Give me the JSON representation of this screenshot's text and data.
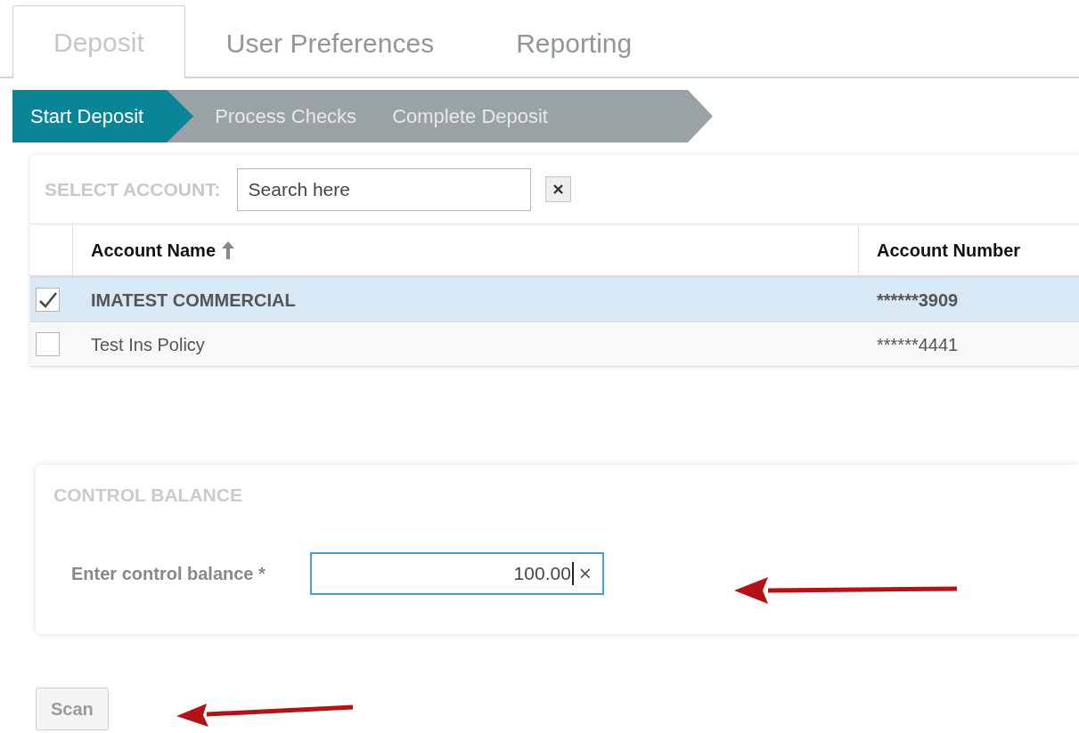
{
  "tabs": [
    {
      "label": "Deposit",
      "selected": true
    },
    {
      "label": "User Preferences",
      "selected": false
    },
    {
      "label": "Reporting",
      "selected": false
    }
  ],
  "steps": [
    {
      "label": "Start Deposit",
      "selected": true
    },
    {
      "label": "Process Checks",
      "selected": false
    },
    {
      "label": "Complete Deposit",
      "selected": false
    }
  ],
  "account_panel": {
    "label": "SELECT ACCOUNT:",
    "search": {
      "placeholder": "Search here"
    },
    "columns": [
      "Account Name",
      "Account Number"
    ],
    "rows": [
      {
        "name": "IMATEST COMMERCIAL",
        "number": "******3909",
        "selected": true
      },
      {
        "name": "Test Ins Policy",
        "number": "******4441",
        "selected": false
      }
    ]
  },
  "control_balance": {
    "title": "CONTROL BALANCE",
    "label": "Enter control balance *",
    "value": "100.00",
    "clear": "×"
  },
  "buttons": [
    {
      "label": "Scan",
      "disabled": true
    }
  ]
}
